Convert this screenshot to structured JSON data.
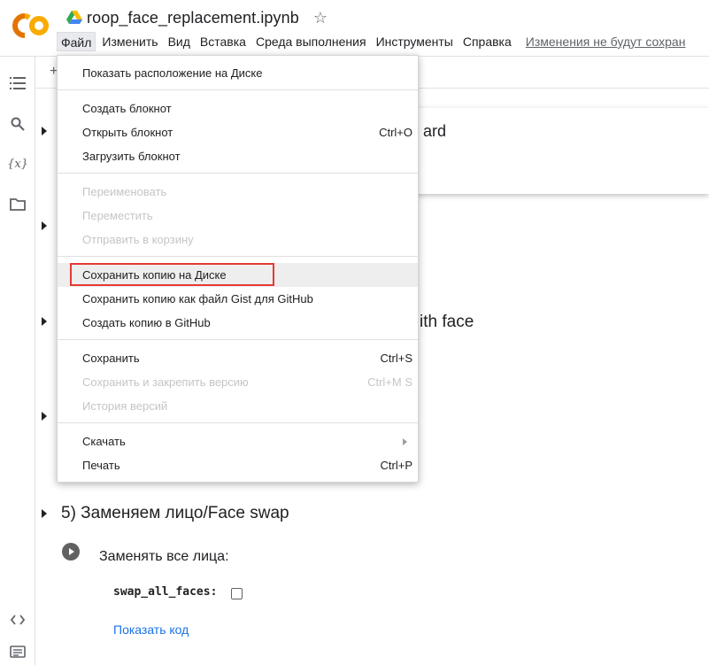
{
  "app": {
    "title": "roop_face_replacement.ipynb",
    "logo_text": "CO",
    "star_icon": "star-outline-icon",
    "drive_icon": "google-drive-icon"
  },
  "menubar": {
    "items": [
      "Файл",
      "Изменить",
      "Вид",
      "Вставка",
      "Среда выполнения",
      "Инструменты",
      "Справка"
    ],
    "active": "Файл",
    "unsaved": "Изменения не будут сохран"
  },
  "sidebar": {
    "icons": [
      "table-of-contents-icon",
      "search-icon",
      "variables-icon",
      "folder-icon",
      "code-snippets-icon",
      "terminal-icon"
    ]
  },
  "notebook": {
    "toolbar_plus": "+",
    "popup_text_fragment": "ard",
    "heading_fragment": "ith face",
    "cell_heading": "5) Заменяем лицо/Face swap",
    "form_title": "Заменять все лица:",
    "param_label": "swap_all_faces:",
    "show_code": "Показать код"
  },
  "file_menu": {
    "group1": [
      {
        "label": "Показать расположение на Диске",
        "shortcut": "",
        "disabled": false
      }
    ],
    "group2": [
      {
        "label": "Создать блокнот",
        "shortcut": "",
        "disabled": false
      },
      {
        "label": "Открыть блокнот",
        "shortcut": "Ctrl+O",
        "disabled": false
      },
      {
        "label": "Загрузить блокнот",
        "shortcut": "",
        "disabled": false
      }
    ],
    "group3": [
      {
        "label": "Переименовать",
        "shortcut": "",
        "disabled": true
      },
      {
        "label": "Переместить",
        "shortcut": "",
        "disabled": true
      },
      {
        "label": "Отправить в корзину",
        "shortcut": "",
        "disabled": true
      }
    ],
    "group4": [
      {
        "label": "Сохранить копию на Диске",
        "shortcut": "",
        "disabled": false,
        "highlighted": true
      },
      {
        "label": "Сохранить копию как файл Gist для GitHub",
        "shortcut": "",
        "disabled": false
      },
      {
        "label": "Создать копию в GitHub",
        "shortcut": "",
        "disabled": false
      }
    ],
    "group5": [
      {
        "label": "Сохранить",
        "shortcut": "Ctrl+S",
        "disabled": false
      },
      {
        "label": "Сохранить и закрепить версию",
        "shortcut": "Ctrl+M S",
        "disabled": true
      },
      {
        "label": "История версий",
        "shortcut": "",
        "disabled": true
      }
    ],
    "group6": [
      {
        "label": "Скачать",
        "shortcut": "",
        "disabled": false,
        "submenu": true
      },
      {
        "label": "Печать",
        "shortcut": "Ctrl+P",
        "disabled": false
      }
    ]
  },
  "colors": {
    "logo_orange": "#f9ab00",
    "logo_dark_orange": "#e37400",
    "highlight_red": "#e53935",
    "link_blue": "#1a73e8"
  }
}
